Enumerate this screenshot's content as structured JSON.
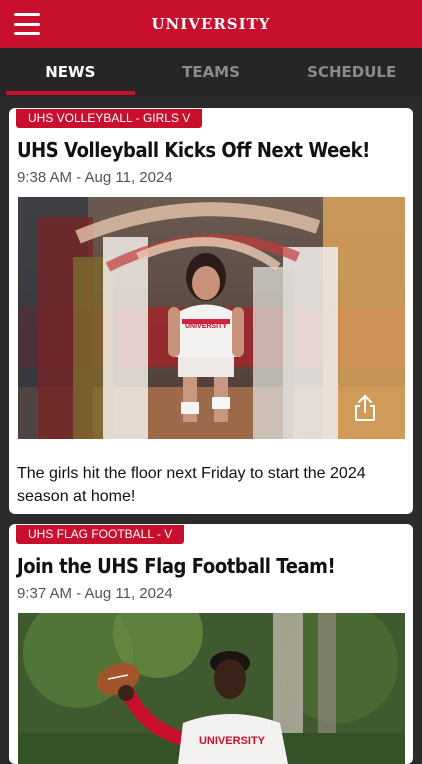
{
  "header": {
    "title": "UNIVERSITY"
  },
  "tabs": [
    {
      "label": "NEWS",
      "active": true
    },
    {
      "label": "TEAMS",
      "active": false
    },
    {
      "label": "SCHEDULE",
      "active": false
    }
  ],
  "colors": {
    "brand": "#c8102e",
    "tab_bar": "#262626",
    "background": "#2b2b2b"
  },
  "feed": {
    "cards": [
      {
        "category": "UHS VOLLEYBALL - GIRLS V",
        "headline": "UHS Volleyball Kicks Off Next Week!",
        "timestamp": "9:38 AM - Aug 11, 2024",
        "jersey_text": "UNIVERSITY",
        "description": "The girls hit the floor next Friday to start the 2024 season at home!",
        "share_icon": "share-icon"
      },
      {
        "category": "UHS FLAG FOOTBALL - V",
        "headline": "Join the UHS Flag Football Team!",
        "timestamp": "9:37 AM - Aug 11, 2024",
        "jersey_text": "UNIVERSITY"
      }
    ]
  }
}
